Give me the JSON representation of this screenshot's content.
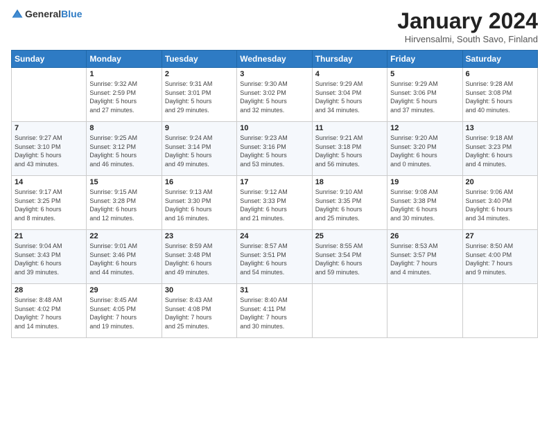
{
  "logo": {
    "general": "General",
    "blue": "Blue"
  },
  "title": "January 2024",
  "location": "Hirvensalmi, South Savo, Finland",
  "days_of_week": [
    "Sunday",
    "Monday",
    "Tuesday",
    "Wednesday",
    "Thursday",
    "Friday",
    "Saturday"
  ],
  "weeks": [
    [
      {
        "day": "",
        "info": ""
      },
      {
        "day": "1",
        "info": "Sunrise: 9:32 AM\nSunset: 2:59 PM\nDaylight: 5 hours\nand 27 minutes."
      },
      {
        "day": "2",
        "info": "Sunrise: 9:31 AM\nSunset: 3:01 PM\nDaylight: 5 hours\nand 29 minutes."
      },
      {
        "day": "3",
        "info": "Sunrise: 9:30 AM\nSunset: 3:02 PM\nDaylight: 5 hours\nand 32 minutes."
      },
      {
        "day": "4",
        "info": "Sunrise: 9:29 AM\nSunset: 3:04 PM\nDaylight: 5 hours\nand 34 minutes."
      },
      {
        "day": "5",
        "info": "Sunrise: 9:29 AM\nSunset: 3:06 PM\nDaylight: 5 hours\nand 37 minutes."
      },
      {
        "day": "6",
        "info": "Sunrise: 9:28 AM\nSunset: 3:08 PM\nDaylight: 5 hours\nand 40 minutes."
      }
    ],
    [
      {
        "day": "7",
        "info": "Sunrise: 9:27 AM\nSunset: 3:10 PM\nDaylight: 5 hours\nand 43 minutes."
      },
      {
        "day": "8",
        "info": "Sunrise: 9:25 AM\nSunset: 3:12 PM\nDaylight: 5 hours\nand 46 minutes."
      },
      {
        "day": "9",
        "info": "Sunrise: 9:24 AM\nSunset: 3:14 PM\nDaylight: 5 hours\nand 49 minutes."
      },
      {
        "day": "10",
        "info": "Sunrise: 9:23 AM\nSunset: 3:16 PM\nDaylight: 5 hours\nand 53 minutes."
      },
      {
        "day": "11",
        "info": "Sunrise: 9:21 AM\nSunset: 3:18 PM\nDaylight: 5 hours\nand 56 minutes."
      },
      {
        "day": "12",
        "info": "Sunrise: 9:20 AM\nSunset: 3:20 PM\nDaylight: 6 hours\nand 0 minutes."
      },
      {
        "day": "13",
        "info": "Sunrise: 9:18 AM\nSunset: 3:23 PM\nDaylight: 6 hours\nand 4 minutes."
      }
    ],
    [
      {
        "day": "14",
        "info": "Sunrise: 9:17 AM\nSunset: 3:25 PM\nDaylight: 6 hours\nand 8 minutes."
      },
      {
        "day": "15",
        "info": "Sunrise: 9:15 AM\nSunset: 3:28 PM\nDaylight: 6 hours\nand 12 minutes."
      },
      {
        "day": "16",
        "info": "Sunrise: 9:13 AM\nSunset: 3:30 PM\nDaylight: 6 hours\nand 16 minutes."
      },
      {
        "day": "17",
        "info": "Sunrise: 9:12 AM\nSunset: 3:33 PM\nDaylight: 6 hours\nand 21 minutes."
      },
      {
        "day": "18",
        "info": "Sunrise: 9:10 AM\nSunset: 3:35 PM\nDaylight: 6 hours\nand 25 minutes."
      },
      {
        "day": "19",
        "info": "Sunrise: 9:08 AM\nSunset: 3:38 PM\nDaylight: 6 hours\nand 30 minutes."
      },
      {
        "day": "20",
        "info": "Sunrise: 9:06 AM\nSunset: 3:40 PM\nDaylight: 6 hours\nand 34 minutes."
      }
    ],
    [
      {
        "day": "21",
        "info": "Sunrise: 9:04 AM\nSunset: 3:43 PM\nDaylight: 6 hours\nand 39 minutes."
      },
      {
        "day": "22",
        "info": "Sunrise: 9:01 AM\nSunset: 3:46 PM\nDaylight: 6 hours\nand 44 minutes."
      },
      {
        "day": "23",
        "info": "Sunrise: 8:59 AM\nSunset: 3:48 PM\nDaylight: 6 hours\nand 49 minutes."
      },
      {
        "day": "24",
        "info": "Sunrise: 8:57 AM\nSunset: 3:51 PM\nDaylight: 6 hours\nand 54 minutes."
      },
      {
        "day": "25",
        "info": "Sunrise: 8:55 AM\nSunset: 3:54 PM\nDaylight: 6 hours\nand 59 minutes."
      },
      {
        "day": "26",
        "info": "Sunrise: 8:53 AM\nSunset: 3:57 PM\nDaylight: 7 hours\nand 4 minutes."
      },
      {
        "day": "27",
        "info": "Sunrise: 8:50 AM\nSunset: 4:00 PM\nDaylight: 7 hours\nand 9 minutes."
      }
    ],
    [
      {
        "day": "28",
        "info": "Sunrise: 8:48 AM\nSunset: 4:02 PM\nDaylight: 7 hours\nand 14 minutes."
      },
      {
        "day": "29",
        "info": "Sunrise: 8:45 AM\nSunset: 4:05 PM\nDaylight: 7 hours\nand 19 minutes."
      },
      {
        "day": "30",
        "info": "Sunrise: 8:43 AM\nSunset: 4:08 PM\nDaylight: 7 hours\nand 25 minutes."
      },
      {
        "day": "31",
        "info": "Sunrise: 8:40 AM\nSunset: 4:11 PM\nDaylight: 7 hours\nand 30 minutes."
      },
      {
        "day": "",
        "info": ""
      },
      {
        "day": "",
        "info": ""
      },
      {
        "day": "",
        "info": ""
      }
    ]
  ]
}
